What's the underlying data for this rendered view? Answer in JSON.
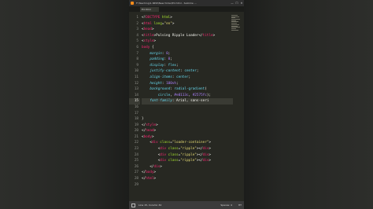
{
  "window": {
    "title": "F:\\Teaching\\1-NEW\\New folder\\Ed.html - Sublime ...",
    "minimize": "—",
    "maximize": "☐",
    "close": "✕"
  },
  "tab": {
    "label": "Ed.html"
  },
  "editor": {
    "active_line": 15,
    "lines": [
      [
        [
          "t-txt",
          "<!"
        ],
        [
          "t-tag",
          "DOCTYPE"
        ],
        [
          "t-txt",
          " "
        ],
        [
          "t-attr",
          "html"
        ],
        [
          "t-txt",
          ">"
        ]
      ],
      [
        [
          "t-txt",
          "<"
        ],
        [
          "t-tag",
          "html"
        ],
        [
          "t-txt",
          " "
        ],
        [
          "t-attr",
          "lang"
        ],
        [
          "t-txt",
          "="
        ],
        [
          "t-str",
          "\"en\""
        ],
        [
          "t-txt",
          ">"
        ]
      ],
      [
        [
          "t-txt",
          "<"
        ],
        [
          "t-tag",
          "head"
        ],
        [
          "t-txt",
          ">"
        ]
      ],
      [
        [
          "t-txt",
          "<"
        ],
        [
          "t-tag",
          "title"
        ],
        [
          "t-txt",
          ">Pulsing Ripple Loader</"
        ],
        [
          "t-tag",
          "title"
        ],
        [
          "t-txt",
          ">"
        ]
      ],
      [
        [
          "t-txt",
          "<"
        ],
        [
          "t-tag",
          "style"
        ],
        [
          "t-txt",
          ">"
        ]
      ],
      [
        [
          "t-sel",
          "body"
        ],
        [
          "t-txt",
          " {"
        ]
      ],
      [
        [
          "t-txt",
          "    "
        ],
        [
          "t-prop",
          "margin"
        ],
        [
          "t-txt",
          ": "
        ],
        [
          "t-val",
          "0"
        ],
        [
          "t-txt",
          ";"
        ]
      ],
      [
        [
          "t-txt",
          "    "
        ],
        [
          "t-prop",
          "padding"
        ],
        [
          "t-txt",
          ": "
        ],
        [
          "t-val",
          "0"
        ],
        [
          "t-txt",
          ";"
        ]
      ],
      [
        [
          "t-txt",
          "    "
        ],
        [
          "t-prop",
          "display"
        ],
        [
          "t-txt",
          ": "
        ],
        [
          "t-fn",
          "flex"
        ],
        [
          "t-txt",
          ";"
        ]
      ],
      [
        [
          "t-txt",
          "    "
        ],
        [
          "t-prop",
          "justify-content"
        ],
        [
          "t-txt",
          ": "
        ],
        [
          "t-fn",
          "center"
        ],
        [
          "t-txt",
          ";"
        ]
      ],
      [
        [
          "t-txt",
          "    "
        ],
        [
          "t-prop",
          "align-items"
        ],
        [
          "t-txt",
          ": "
        ],
        [
          "t-fn",
          "center"
        ],
        [
          "t-txt",
          ";"
        ]
      ],
      [
        [
          "t-txt",
          "    "
        ],
        [
          "t-prop",
          "height"
        ],
        [
          "t-txt",
          ": "
        ],
        [
          "t-val",
          "100vh"
        ],
        [
          "t-txt",
          ";"
        ]
      ],
      [
        [
          "t-txt",
          "    "
        ],
        [
          "t-prop",
          "background"
        ],
        [
          "t-txt",
          ": "
        ],
        [
          "t-fn",
          "radial-gradient"
        ],
        [
          "t-txt",
          "("
        ]
      ],
      [
        [
          "t-txt",
          "        "
        ],
        [
          "t-fn",
          "circle"
        ],
        [
          "t-txt",
          ", "
        ],
        [
          "t-val",
          "#e0113c"
        ],
        [
          "t-txt",
          ", "
        ],
        [
          "t-val",
          "#2575fc"
        ],
        [
          "t-txt",
          ");"
        ]
      ],
      [
        [
          "t-txt",
          "    "
        ],
        [
          "t-prop",
          "font-family"
        ],
        [
          "t-txt",
          ": Arial, sans-ser"
        ],
        [
          "t-txt",
          "i"
        ]
      ],
      [
        [
          "t-txt",
          ""
        ]
      ],
      [
        [
          "t-txt",
          ""
        ]
      ],
      [
        [
          "t-txt",
          "}"
        ]
      ],
      [
        [
          "t-txt",
          "</"
        ],
        [
          "t-tag",
          "style"
        ],
        [
          "t-txt",
          ">"
        ]
      ],
      [
        [
          "t-txt",
          "</"
        ],
        [
          "t-tag",
          "head"
        ],
        [
          "t-txt",
          ">"
        ]
      ],
      [
        [
          "t-txt",
          "<"
        ],
        [
          "t-tag",
          "body"
        ],
        [
          "t-txt",
          ">"
        ]
      ],
      [
        [
          "t-txt",
          "    <"
        ],
        [
          "t-tag",
          "div"
        ],
        [
          "t-txt",
          " "
        ],
        [
          "t-attr",
          "class"
        ],
        [
          "t-txt",
          "="
        ],
        [
          "t-str",
          "\"loader-container\""
        ],
        [
          "t-txt",
          ">"
        ]
      ],
      [
        [
          "t-txt",
          "        <"
        ],
        [
          "t-tag",
          "div"
        ],
        [
          "t-txt",
          " "
        ],
        [
          "t-attr",
          "class"
        ],
        [
          "t-txt",
          "="
        ],
        [
          "t-str",
          "\"ripple\""
        ],
        [
          "t-txt",
          "></"
        ],
        [
          "t-tag",
          "div"
        ],
        [
          "t-txt",
          ">"
        ]
      ],
      [
        [
          "t-txt",
          "        <"
        ],
        [
          "t-tag",
          "div"
        ],
        [
          "t-txt",
          " "
        ],
        [
          "t-attr",
          "class"
        ],
        [
          "t-txt",
          "="
        ],
        [
          "t-str",
          "\"ripple\""
        ],
        [
          "t-txt",
          "></"
        ],
        [
          "t-tag",
          "div"
        ],
        [
          "t-txt",
          ">"
        ]
      ],
      [
        [
          "t-txt",
          "        <"
        ],
        [
          "t-tag",
          "div"
        ],
        [
          "t-txt",
          " "
        ],
        [
          "t-attr",
          "class"
        ],
        [
          "t-txt",
          "="
        ],
        [
          "t-str",
          "\"ripple\""
        ],
        [
          "t-txt",
          "></"
        ],
        [
          "t-tag",
          "div"
        ],
        [
          "t-txt",
          ">"
        ]
      ],
      [
        [
          "t-txt",
          "    </"
        ],
        [
          "t-tag",
          "div"
        ],
        [
          "t-txt",
          ">"
        ]
      ],
      [
        [
          "t-txt",
          "</"
        ],
        [
          "t-tag",
          "body"
        ],
        [
          "t-txt",
          ">"
        ]
      ],
      [
        [
          "t-txt",
          "</"
        ],
        [
          "t-tag",
          "html"
        ],
        [
          "t-txt",
          ">"
        ]
      ],
      [
        [
          "t-txt",
          ""
        ]
      ]
    ]
  },
  "status": {
    "position": "Line 15, Column 34",
    "spaces": "Spaces: 4",
    "syntax": "HT"
  },
  "icons": {
    "app": "sublime-text-icon",
    "status": "panel-toggle-icon"
  },
  "colors": {
    "editor_bg": "#272822",
    "tag": "#f92672",
    "attribute": "#a6e22e",
    "string": "#e6db74",
    "property": "#66d9ef",
    "number": "#ae81ff"
  }
}
